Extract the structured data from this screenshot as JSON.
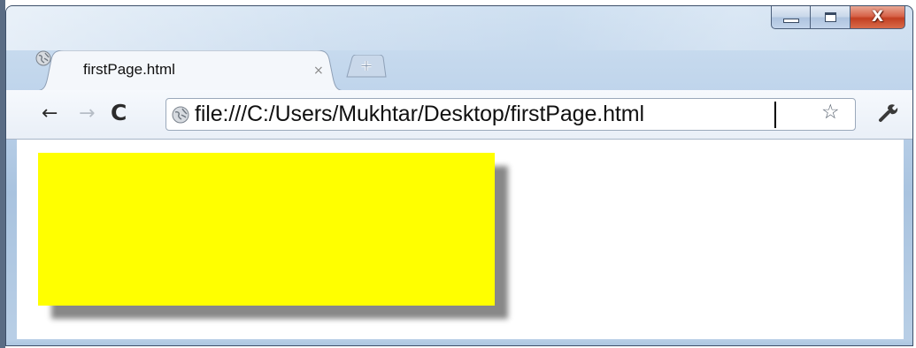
{
  "window": {
    "caption_buttons": {
      "minimize_icon": "minimize-icon",
      "maximize_icon": "maximize-icon",
      "close_glyph": "X"
    }
  },
  "tab": {
    "title": "firstPage.html",
    "close_glyph": "×",
    "favicon": "globe-icon"
  },
  "newtab": {
    "icon": "plus-icon"
  },
  "toolbar": {
    "back_glyph": "←",
    "forward_glyph": "→",
    "reload_glyph": "C",
    "url": "file:///C:/Users/Mukhtar/Desktop/firstPage.html",
    "star_glyph": "☆",
    "wrench_icon": "wrench-icon"
  },
  "content": {
    "box_color": "#ffff00",
    "shadow_color": "#888888"
  }
}
